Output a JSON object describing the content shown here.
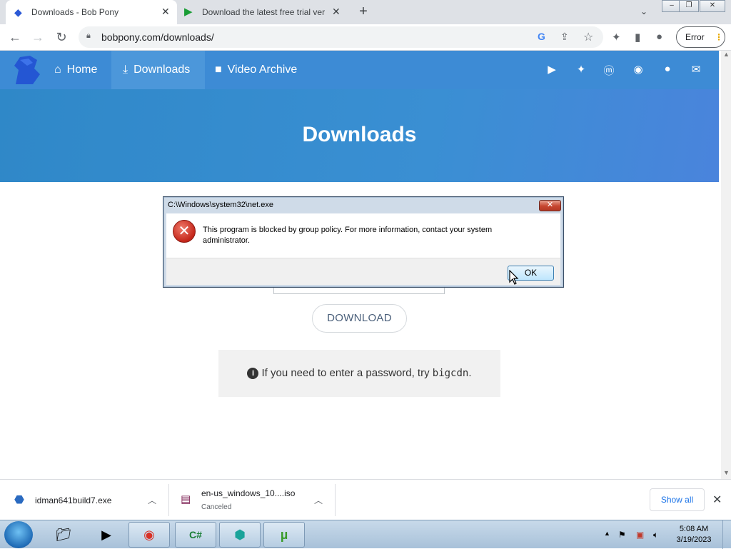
{
  "browser": {
    "tabs": [
      {
        "title": "Downloads - Bob Pony",
        "active": true
      },
      {
        "title": "Download the latest free trial ver",
        "active": false
      }
    ],
    "url": "bobpony.com/downloads/",
    "profile_status": "Error"
  },
  "site": {
    "nav": [
      {
        "label": "Home",
        "icon": "home-icon"
      },
      {
        "label": "Downloads",
        "icon": "download-icon",
        "active": true
      },
      {
        "label": "Video Archive",
        "icon": "video-icon"
      }
    ],
    "social_icons": [
      "youtube-icon",
      "twitter-icon",
      "mastodon-icon",
      "discord-icon",
      "github-icon",
      "email-icon"
    ],
    "hero_title": "Downloads",
    "download_button": "DOWNLOAD",
    "notice_prefix": "If you need to enter a password, try ",
    "notice_code": "bigcdn",
    "notice_suffix": "."
  },
  "dialog": {
    "title": "C:\\Windows\\system32\\net.exe",
    "message": "This program is blocked by group policy. For more information, contact your system administrator.",
    "ok_label": "OK"
  },
  "download_shelf": {
    "items": [
      {
        "name": "idman641build7.exe",
        "status": ""
      },
      {
        "name": "en-us_windows_10....iso",
        "status": "Canceled"
      }
    ],
    "show_all": "Show all"
  },
  "taskbar": {
    "time": "5:08 AM",
    "date": "3/19/2023"
  },
  "colors": {
    "site_nav": "#3d8bd5",
    "hero": "#2f88c8",
    "dialog_frame": "#cfdbe8"
  }
}
